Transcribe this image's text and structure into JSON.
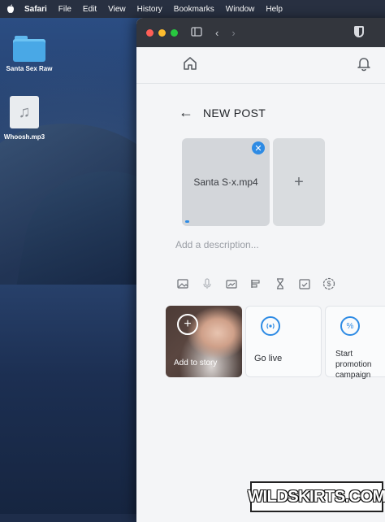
{
  "menubar": {
    "items": [
      "Safari",
      "File",
      "Edit",
      "View",
      "History",
      "Bookmarks",
      "Window",
      "Help"
    ]
  },
  "desktop": {
    "icons": [
      {
        "label": "Santa Sex Raw",
        "icon": "folder-icon"
      },
      {
        "label": "Whoosh.mp3",
        "icon": "audio-file-icon"
      }
    ]
  },
  "browser": {
    "icons": [
      "sidebar-icon",
      "back-icon",
      "forward-icon",
      "shield-icon"
    ]
  },
  "page": {
    "header_title": "NEW POST",
    "media_filename": "Santa S·x.mp4",
    "upload_progress": 0.05,
    "description_placeholder": "Add a description...",
    "tools": [
      "image-icon",
      "microphone-icon",
      "gallery-icon",
      "poll-icon",
      "hourglass-icon",
      "calendar-check-icon",
      "dollar-icon"
    ],
    "cards": {
      "story": "Add to story",
      "live": "Go live",
      "promo": "Start promotion campaign"
    },
    "accent": "#2e8be4"
  },
  "watermark": "WILDSKIRTS.COM"
}
